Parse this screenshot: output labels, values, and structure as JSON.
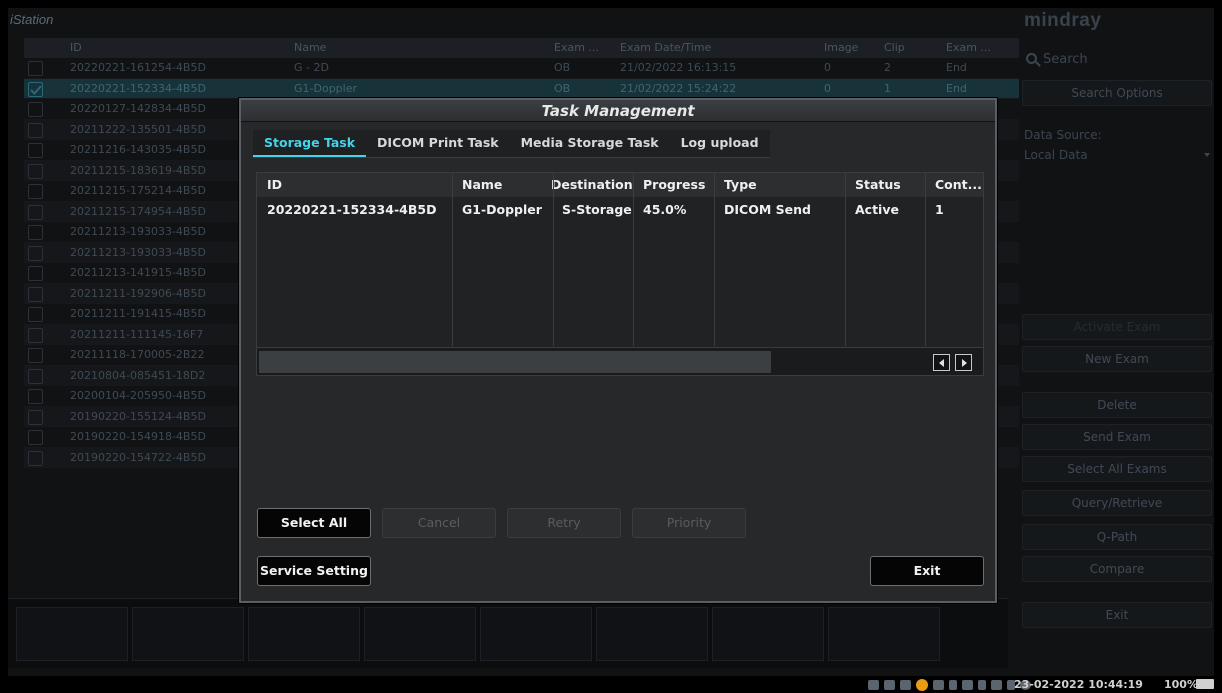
{
  "app": {
    "title": "iStation",
    "columns": [
      "ID",
      "Name",
      "Exam ...",
      "Exam Date/Time",
      "Image",
      "Clip",
      "Exam ..."
    ],
    "rows": [
      {
        "id": "20220221-161254-4B5D",
        "name": "G - 2D",
        "type": "OB",
        "date": "21/02/2022 16:13:15",
        "image": "0",
        "clip": "2",
        "state": "End",
        "checked": false
      },
      {
        "id": "20220221-152334-4B5D",
        "name": "G1-Doppler",
        "type": "OB",
        "date": "21/02/2022 15:24:22",
        "image": "0",
        "clip": "1",
        "state": "End",
        "checked": true
      },
      {
        "id": "20220127-142834-4B5D",
        "name": "",
        "type": "",
        "date": "",
        "image": "",
        "clip": "",
        "state": "",
        "checked": false
      },
      {
        "id": "20211222-135501-4B5D",
        "name": "",
        "type": "",
        "date": "",
        "image": "",
        "clip": "",
        "state": "",
        "checked": false
      },
      {
        "id": "20211216-143035-4B5D",
        "name": "",
        "type": "",
        "date": "",
        "image": "",
        "clip": "",
        "state": "",
        "checked": false
      },
      {
        "id": "20211215-183619-4B5D",
        "name": "",
        "type": "",
        "date": "",
        "image": "",
        "clip": "",
        "state": "",
        "checked": false
      },
      {
        "id": "20211215-175214-4B5D",
        "name": "",
        "type": "",
        "date": "",
        "image": "",
        "clip": "",
        "state": "",
        "checked": false
      },
      {
        "id": "20211215-174954-4B5D",
        "name": "",
        "type": "",
        "date": "",
        "image": "",
        "clip": "",
        "state": "",
        "checked": false
      },
      {
        "id": "20211213-193033-4B5D",
        "name": "",
        "type": "",
        "date": "",
        "image": "",
        "clip": "",
        "state": "",
        "checked": false
      },
      {
        "id": "20211213-193033-4B5D",
        "name": "",
        "type": "",
        "date": "",
        "image": "",
        "clip": "",
        "state": "",
        "checked": false
      },
      {
        "id": "20211213-141915-4B5D",
        "name": "",
        "type": "",
        "date": "",
        "image": "",
        "clip": "",
        "state": "",
        "checked": false
      },
      {
        "id": "20211211-192906-4B5D",
        "name": "",
        "type": "",
        "date": "",
        "image": "",
        "clip": "",
        "state": "",
        "checked": false
      },
      {
        "id": "20211211-191415-4B5D",
        "name": "",
        "type": "",
        "date": "",
        "image": "",
        "clip": "",
        "state": "",
        "checked": false
      },
      {
        "id": "20211211-111145-16F7",
        "name": "",
        "type": "",
        "date": "",
        "image": "",
        "clip": "",
        "state": "",
        "checked": false
      },
      {
        "id": "20211118-170005-2B22",
        "name": "",
        "type": "",
        "date": "",
        "image": "",
        "clip": "",
        "state": "",
        "checked": false
      },
      {
        "id": "20210804-085451-18D2",
        "name": "",
        "type": "",
        "date": "",
        "image": "",
        "clip": "",
        "state": "",
        "checked": false
      },
      {
        "id": "20200104-205950-4B5D",
        "name": "",
        "type": "",
        "date": "",
        "image": "",
        "clip": "",
        "state": "",
        "checked": false
      },
      {
        "id": "20190220-155124-4B5D",
        "name": "",
        "type": "",
        "date": "",
        "image": "",
        "clip": "",
        "state": "",
        "checked": false
      },
      {
        "id": "20190220-154918-4B5D",
        "name": "",
        "type": "",
        "date": "",
        "image": "",
        "clip": "",
        "state": "",
        "checked": false
      },
      {
        "id": "20190220-154722-4B5D",
        "name": "",
        "type": "",
        "date": "",
        "image": "",
        "clip": "",
        "state": "",
        "checked": false
      }
    ]
  },
  "right_panel": {
    "logo": "mindray",
    "search_label": "Search",
    "search_options": "Search Options",
    "data_source_label": "Data Source:",
    "data_source_value": "Local Data",
    "activate_exam": "Activate Exam",
    "new_exam": "New Exam",
    "delete": "Delete",
    "send_exam": "Send Exam",
    "select_all_exams": "Select All Exams",
    "query_retrieve": "Query/Retrieve",
    "q_path": "Q-Path",
    "compare": "Compare",
    "exit": "Exit"
  },
  "status_bar": {
    "datetime": "23-02-2022 10:44:19",
    "zoom": "100%"
  },
  "dialog": {
    "title": "Task Management",
    "tabs": [
      "Storage Task",
      "DICOM Print Task",
      "Media Storage Task",
      "Log upload"
    ],
    "active_tab": 0,
    "table": {
      "columns": [
        "ID",
        "Name",
        "Destination",
        "Progress",
        "Type",
        "Status",
        "Cont..."
      ],
      "rows": [
        {
          "id": "20220221-152334-4B5D",
          "name": "G1-Doppler",
          "destination": "S-Storage",
          "progress": "45.0%",
          "type": "DICOM Send",
          "status": "Active",
          "count": "1"
        }
      ]
    },
    "buttons": {
      "select_all": "Select All",
      "cancel": "Cancel",
      "retry": "Retry",
      "priority": "Priority",
      "service_setting": "Service Setting",
      "exit": "Exit"
    }
  }
}
